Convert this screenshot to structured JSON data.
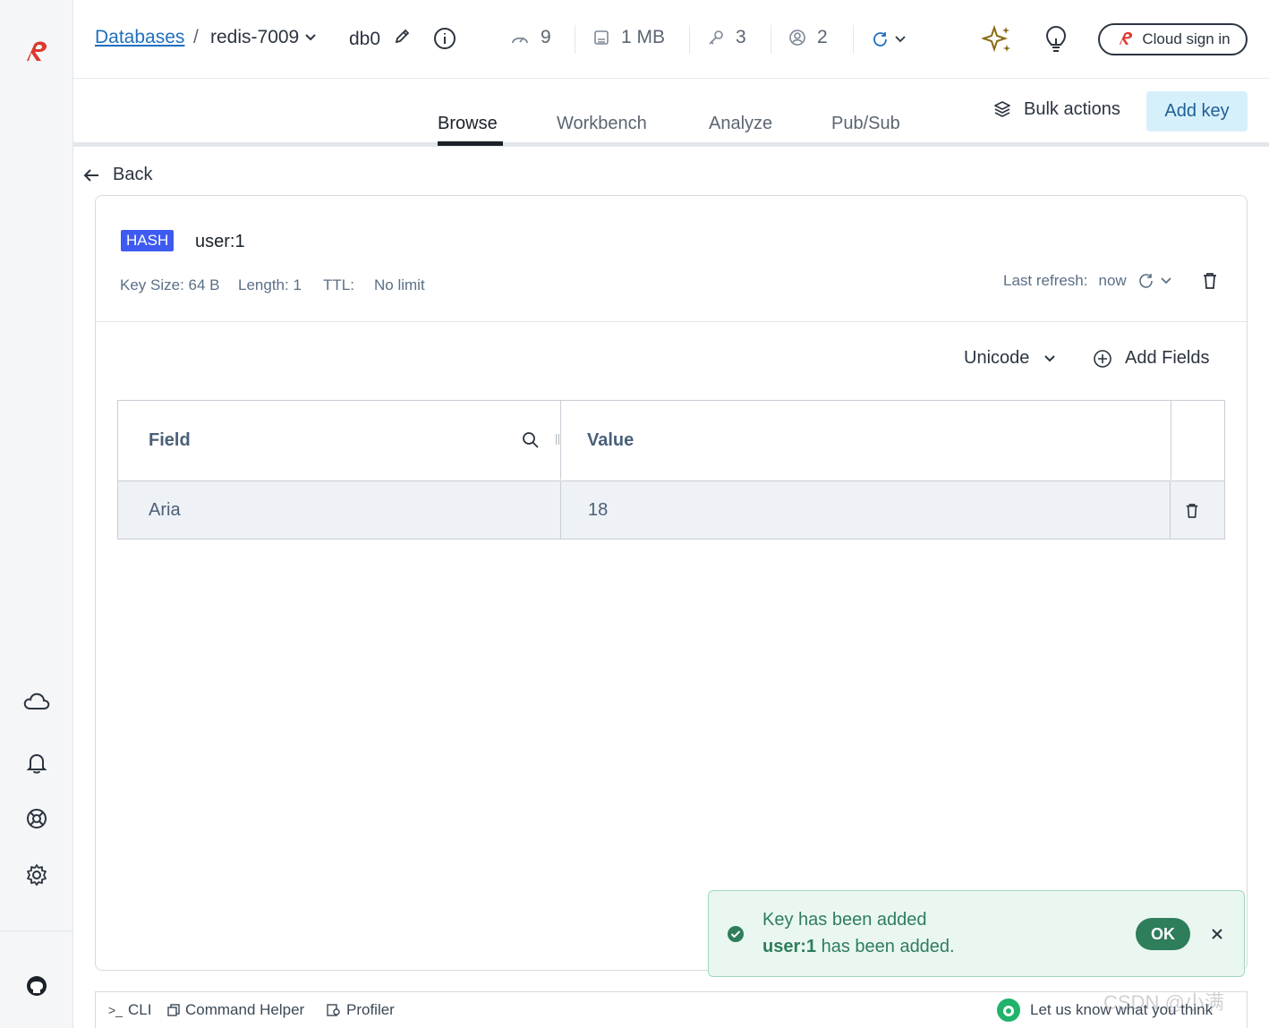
{
  "sidebar": {
    "logo": "redis-logo-icon",
    "bottom_icons": [
      "cloud-icon",
      "bell-icon",
      "lifebuoy-icon",
      "gear-icon",
      "github-icon"
    ]
  },
  "header": {
    "breadcrumb_link": "Databases",
    "breadcrumb_sep": "/",
    "database": "redis-7009",
    "db_index": "db0",
    "stats": {
      "ops": "9",
      "memory": "1 MB",
      "keys": "3",
      "clients": "2"
    },
    "cloud_sign_in": "Cloud sign in"
  },
  "tabs": [
    "Browse",
    "Workbench",
    "Analyze",
    "Pub/Sub"
  ],
  "active_tab": "Browse",
  "actions": {
    "bulk_actions": "Bulk actions",
    "add_key": "Add key"
  },
  "back_label": "Back",
  "key": {
    "type": "HASH",
    "name": "user:1",
    "size_label": "Key Size: 64 B",
    "length_label": "Length: 1",
    "ttl_label": "TTL:",
    "ttl_value": "No limit",
    "last_refresh_label": "Last refresh:",
    "last_refresh_value": "now"
  },
  "toolbar": {
    "format": "Unicode",
    "add_fields": "Add Fields"
  },
  "table": {
    "columns": [
      "Field",
      "Value"
    ],
    "rows": [
      {
        "field": "Aria",
        "value": "18"
      }
    ]
  },
  "toast": {
    "title": "Key has been added",
    "key": "user:1",
    "message": " has been added.",
    "ok": "OK"
  },
  "bottom_bar": {
    "cli": "CLI",
    "command_helper": "Command Helper",
    "profiler": "Profiler",
    "feedback": "Let us know what you think",
    "watermark": "CSDN @小满"
  },
  "colors": {
    "accent": "#3d5af1",
    "link": "#1e6fbf",
    "success": "#2e7d5b",
    "brand": "#dc382d"
  }
}
